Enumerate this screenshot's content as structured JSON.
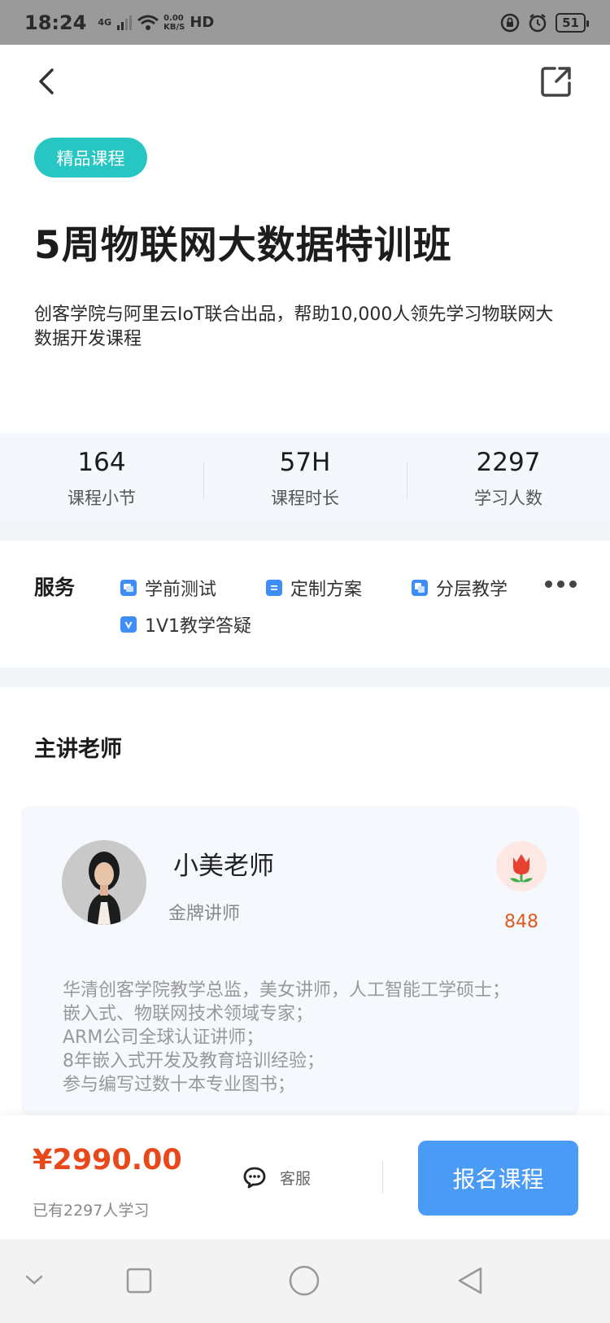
{
  "status_bar": {
    "time": "18:24",
    "network": "4G",
    "speed_value": "0.00",
    "speed_unit": "KB/S",
    "hd": "HD",
    "battery": "51"
  },
  "course": {
    "tag": "精品课程",
    "title": "5周物联网大数据特训班",
    "description": "创客学院与阿里云IoT联合出品，帮助10,000人领先学习物联网大数据开发课程"
  },
  "stats": [
    {
      "value": "164",
      "label": "课程小节"
    },
    {
      "value": "57H",
      "label": "课程时长"
    },
    {
      "value": "2297",
      "label": "学习人数"
    }
  ],
  "services": {
    "label": "服务",
    "items": [
      {
        "label": "学前测试",
        "icon": "chat-bubbles-icon"
      },
      {
        "label": "定制方案",
        "icon": "document-icon"
      },
      {
        "label": "分层教学",
        "icon": "layers-icon"
      },
      {
        "label": "1V1教学答疑",
        "icon": "check-badge-icon"
      }
    ]
  },
  "teacher_section": {
    "title": "主讲老师",
    "name": "小美老师",
    "rank": "金牌讲师",
    "flowers": "848",
    "bio": [
      "华清创客学院教学总监，美女讲师，人工智能工学硕士；",
      "嵌入式、物联网技术领域专家；",
      "ARM公司全球认证讲师；",
      "8年嵌入式开发及教育培训经验；",
      "参与编写过数十本专业图书；"
    ]
  },
  "purchase": {
    "price": "¥2990.00",
    "learners": "已有2297人学习",
    "customer_service": "客服",
    "enroll": "报名课程"
  },
  "colors": {
    "tag_bg": "#27c6c2",
    "price": "#e8481a",
    "enroll_bg": "#4a9bf5",
    "service_icon": "#3f8ef7"
  }
}
